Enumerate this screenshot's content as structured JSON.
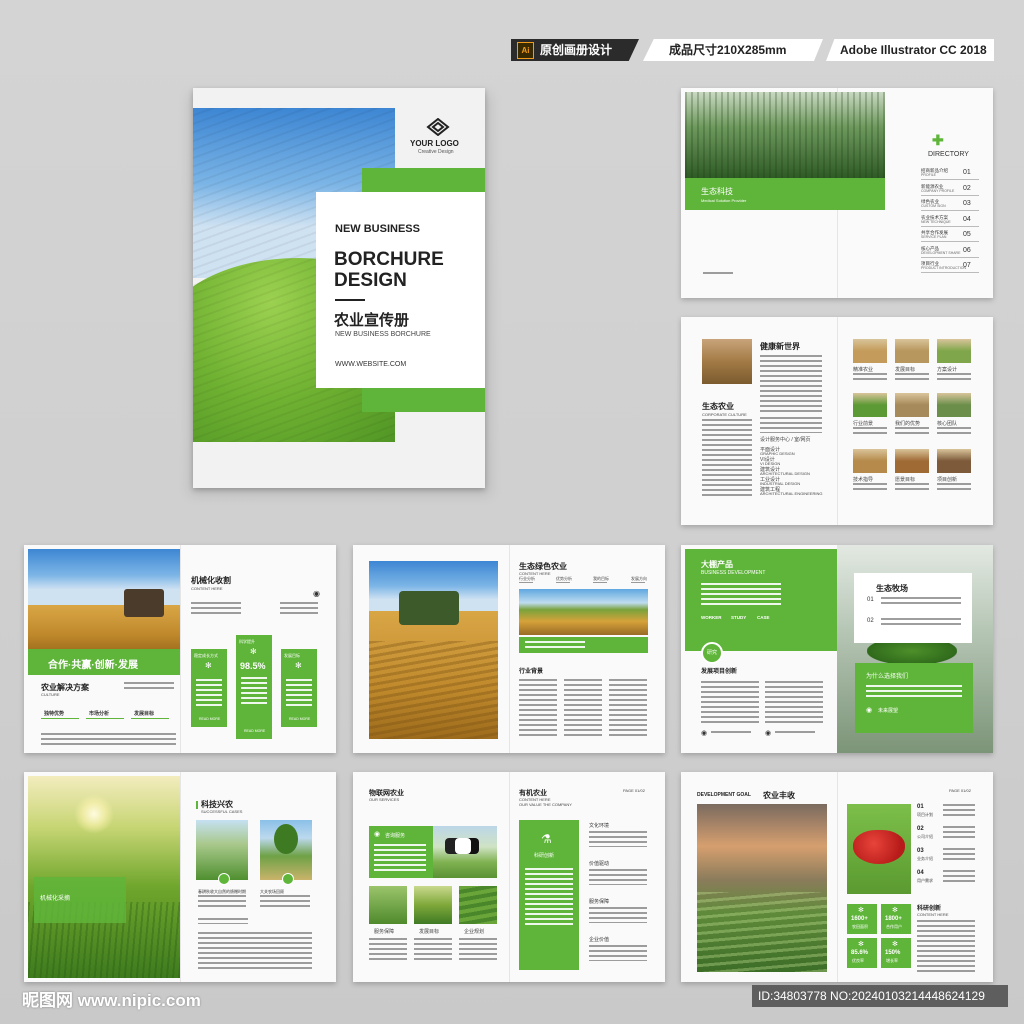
{
  "tags": {
    "software_icon": "Ai",
    "made": "原创画册设计",
    "size": "成品尺寸210X285mm",
    "software": "Adobe Illustrator CC 2018"
  },
  "cover": {
    "logo": "YOUR LOGO",
    "logo_sub": "Creative Design",
    "kicker": "NEW BUSINESS",
    "title1": "BORCHURE",
    "title2": "DESIGN",
    "cn_title": "农业宣传册",
    "subtitle": "NEW BUSINESS  BORCHURE",
    "website": "WWW.WEBSITE.COM"
  },
  "p1": {
    "title": "生态科技",
    "sub": "Medical Solution Provider",
    "directory": "DIRECTORY",
    "items": [
      {
        "cn": "招商新品介绍",
        "en": "PROFILE",
        "n": "01"
      },
      {
        "cn": "新能源农业",
        "en": "COMPANY PROFILE",
        "n": "02"
      },
      {
        "cn": "绿色农业",
        "en": "CUSTOM SIGN",
        "n": "03"
      },
      {
        "cn": "农业技术方案",
        "en": "NEW TECHNIQUE",
        "n": "04"
      },
      {
        "cn": "共享合作发展",
        "en": "SERVICE PLAN",
        "n": "05"
      },
      {
        "cn": "核心产品",
        "en": "DEVELOPMENT SHARE",
        "n": "06"
      },
      {
        "cn": "项目行业",
        "en": "PRODUCT INTRODUCTION",
        "n": "07"
      }
    ]
  },
  "p2": {
    "title": "健康新世界",
    "sub_cn": "生态农业",
    "sub_en": "CORPORATE CULTURE",
    "list": [
      {
        "cn": "设计服务中心 / 室/网页",
        "en": ""
      },
      {
        "cn": "平面设计",
        "en": "GRAPHIC DESIGN"
      },
      {
        "cn": "VI设计",
        "en": "VI DESIGN"
      },
      {
        "cn": "建筑设计",
        "en": "ARCHITECTURAL DESIGN"
      },
      {
        "cn": "工业设计",
        "en": "INDUSTRIAL DESIGN"
      },
      {
        "cn": "建筑工程",
        "en": "ARCHITECTURAL ENGINEERING"
      }
    ],
    "grid": [
      "精准农业",
      "发展目标",
      "方案设计",
      "行业前景",
      "我们的优势",
      "核心团队",
      "技术指导",
      "愿景目标",
      "项目创新"
    ]
  },
  "p3": {
    "title": "机械化收割",
    "title_en": "CONTENT HERE",
    "banner": "合作·共赢·创新·发展",
    "sol": "农业解决方案",
    "sol_en": "CULTURE",
    "tabs": [
      "独特优势",
      "市场分析",
      "发展目标"
    ],
    "cards": [
      {
        "t": "稳定成长方式"
      },
      {
        "t": "科学提升",
        "pct": "98.5%"
      },
      {
        "t": "发展目标"
      }
    ],
    "more": "READ MORE"
  },
  "p4": {
    "title": "生态绿色农业",
    "title_en": "CONTENT HERE",
    "icons": [
      "行业分析",
      "优势分析",
      "我的目标",
      "发展方向"
    ],
    "sub": "行业背景"
  },
  "p5": {
    "title": "大棚产品",
    "title_en": "BUSINESS DEVELOPMENT",
    "tabs": [
      "WORKER",
      "STUDY",
      "CASE"
    ],
    "badge": "研究",
    "dev": "发展项目创新",
    "box_title": "生态牧场",
    "n1": "01",
    "n2": "02",
    "choose": "为什么选择我们",
    "future": "未来展望"
  },
  "p6": {
    "overlay": "机械化采摘",
    "title": "科技兴农",
    "title_en": "SUCCESSFUL CASES",
    "c1": "春耕秋收大自然的馈赠时期",
    "c2": "大关农场回顾"
  },
  "p7": {
    "title": "物联网农业",
    "title_en": "OUR SERVICES",
    "t2": "有机农业",
    "t2_en": "CONTENT HERE",
    "t2_en2": "OUR VALUE THE COMPANY",
    "page": "PAGE 01/02",
    "svc": "咨询服务",
    "labels": [
      "服务保障",
      "发展目标",
      "企业规划"
    ],
    "inno": "科研创新",
    "right": [
      "文化环境",
      "价值驱动",
      "服务保障",
      "企业价值"
    ]
  },
  "p8": {
    "title_en": "DEVELOPMENT GOAL",
    "title": "农业丰收",
    "page": "PAGE 01/02",
    "list": [
      {
        "n": "01",
        "t": "项目计划"
      },
      {
        "n": "02",
        "t": "公司介绍"
      },
      {
        "n": "03",
        "t": "业务介绍"
      },
      {
        "n": "04",
        "t": "用户需求"
      }
    ],
    "res": "科研创新",
    "res_en": "CONTENT HERE",
    "stats": [
      "1600+",
      "1800+",
      "85.6%",
      "150%"
    ],
    "stat_labels": [
      "农田面积",
      "合作用户",
      "优良率",
      "增长率"
    ]
  },
  "footer": {
    "site": "昵图网 www.nipic.com",
    "id": "ID:34803778 NO:20240103214448624129"
  }
}
